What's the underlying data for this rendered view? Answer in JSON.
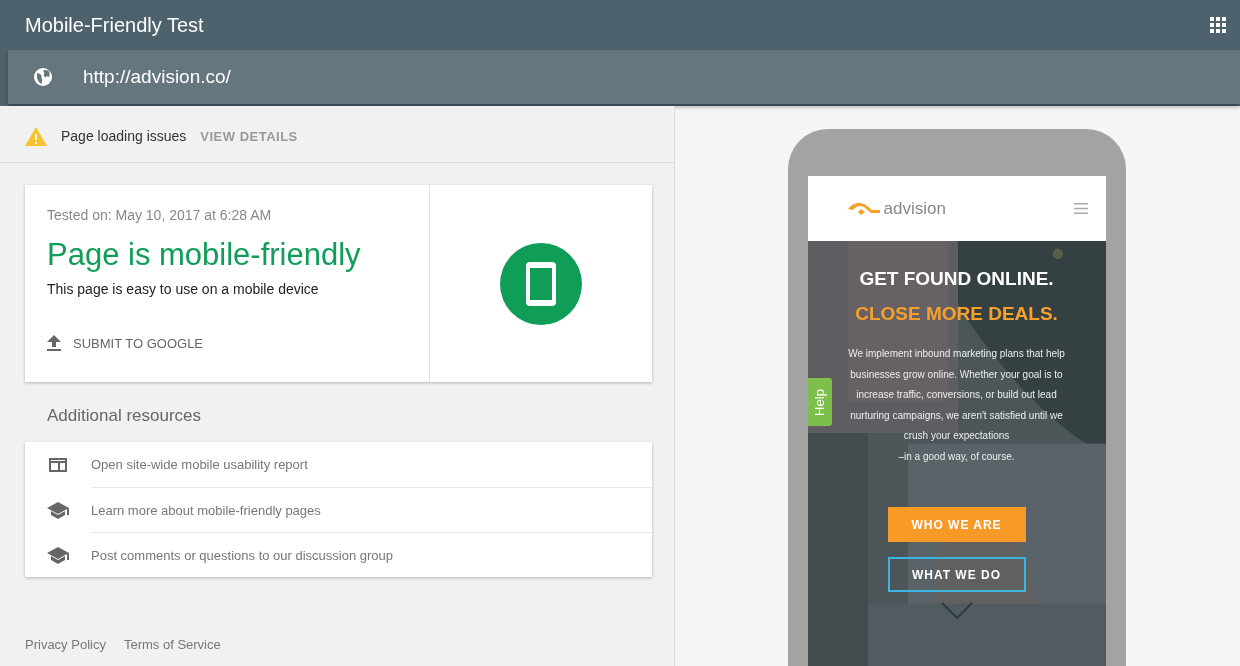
{
  "app_bar": {
    "title": "Mobile-Friendly Test",
    "url": "http://advision.co/"
  },
  "issues_bar": {
    "label": "Page loading issues",
    "action": "VIEW DETAILS"
  },
  "result": {
    "tested_on": "Tested on: May 10, 2017 at 6:28 AM",
    "verdict": "Page is mobile-friendly",
    "description": "This page is easy to use on a mobile device",
    "submit": "SUBMIT TO GOOGLE"
  },
  "resources": {
    "title": "Additional resources",
    "items": [
      {
        "kind": "report",
        "label": "Open site-wide mobile usability report"
      },
      {
        "kind": "school",
        "label": "Learn more about mobile-friendly pages"
      },
      {
        "kind": "school",
        "label": "Post comments or questions to our discussion group"
      }
    ]
  },
  "footer": {
    "links": [
      "Privacy Policy",
      "Terms of Service"
    ]
  },
  "preview": {
    "logo": "advision",
    "headline": "GET FOUND ONLINE.",
    "subheadline": "CLOSE MORE DEALS.",
    "body_lines": [
      "We implement inbound marketing plans that help",
      "businesses grow online. Whether your goal is to",
      "increase traffic, conversions, or build out lead",
      "nurturing campaigns, we aren't satisfied until we",
      "crush your expectations",
      "–in a good way, of course."
    ],
    "help_tab": "Help",
    "buttons": [
      {
        "kind": "filled",
        "label": "WHO WE ARE"
      },
      {
        "kind": "outline",
        "label": "WHAT WE DO"
      }
    ]
  }
}
